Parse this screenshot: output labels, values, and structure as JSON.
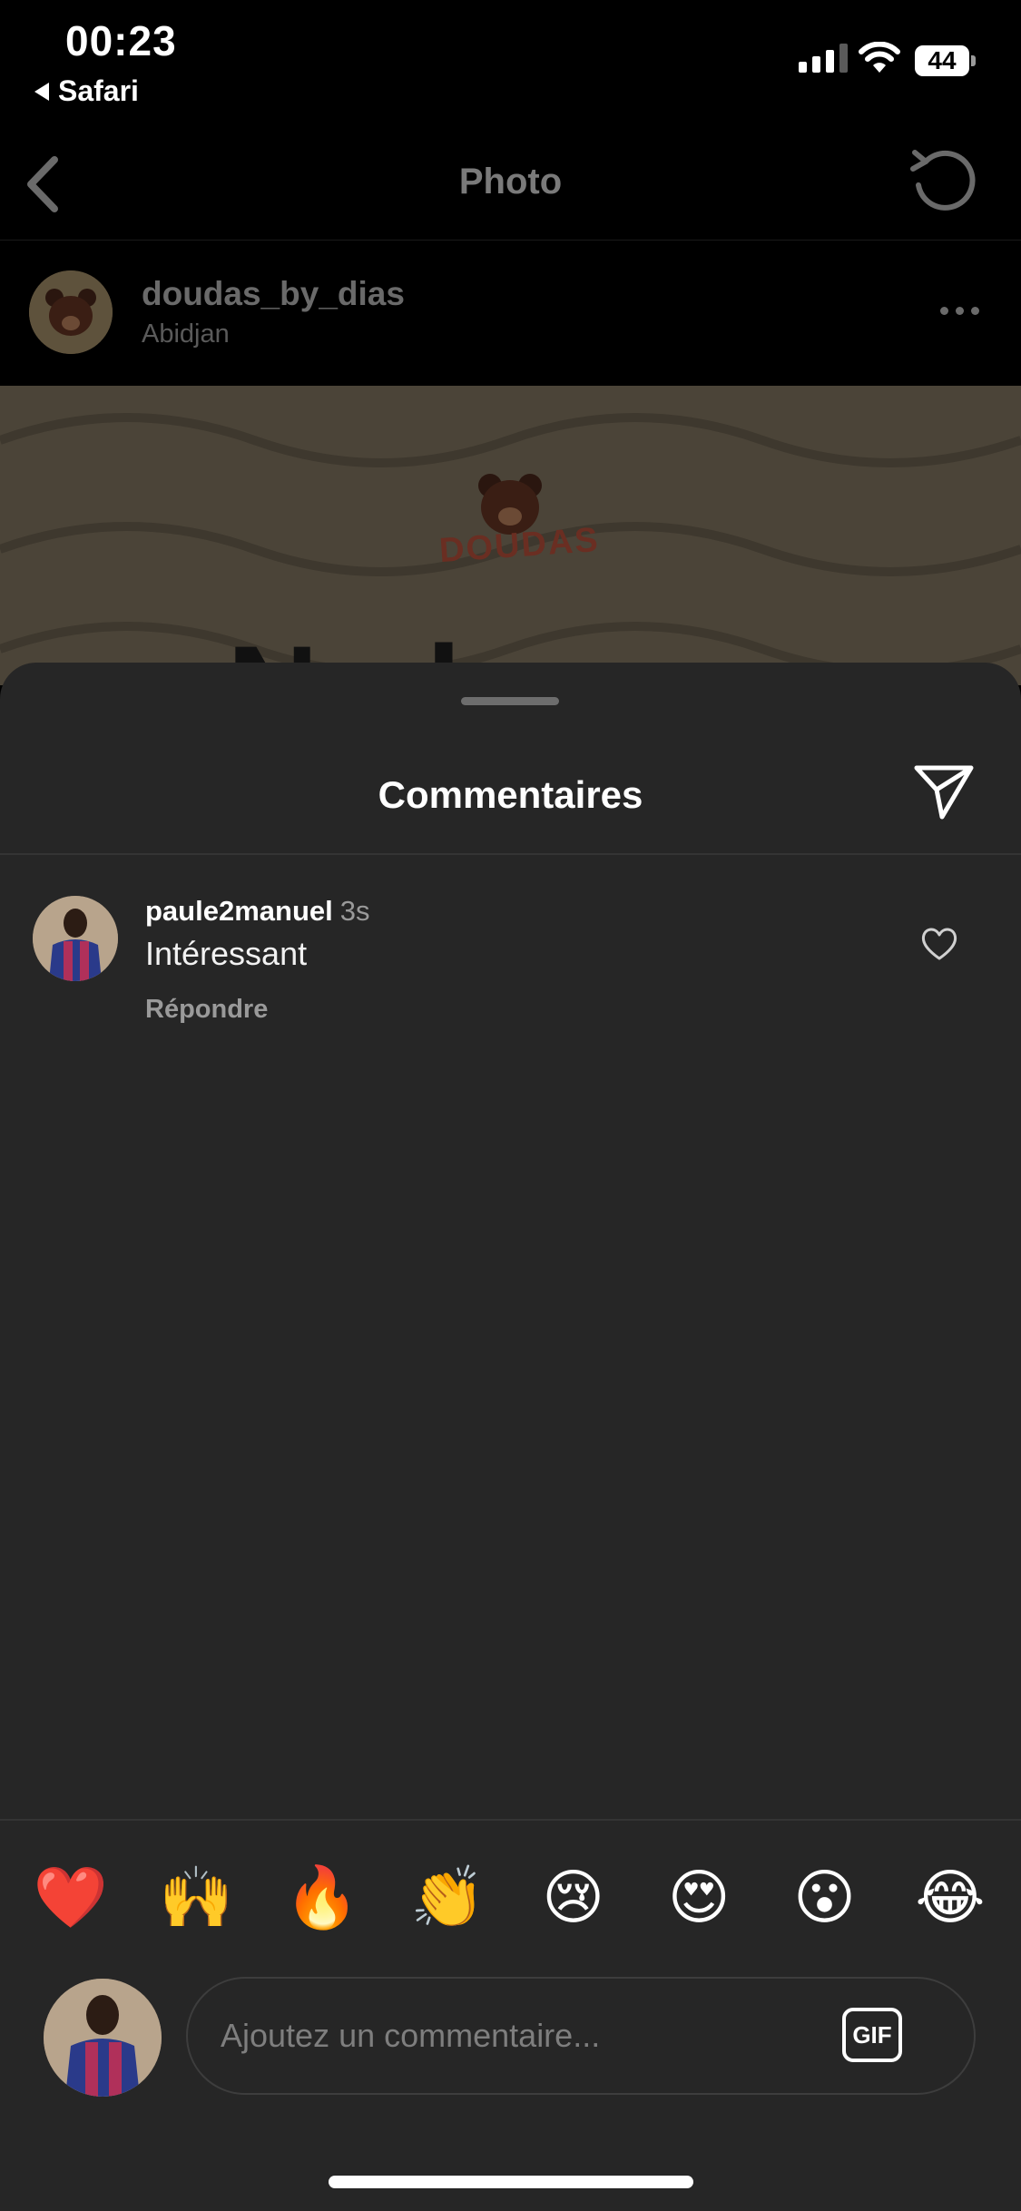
{
  "status_bar": {
    "time": "00:23",
    "back_app": "Safari",
    "battery": "44"
  },
  "background": {
    "nav_title": "Photo",
    "post_username": "doudas_by_dias",
    "post_location": "Abidjan",
    "brand_text": "DOUDAS",
    "large_word_partial": "N    ploy"
  },
  "sheet": {
    "title": "Commentaires"
  },
  "comment": {
    "username": "paule2manuel",
    "time": "3s",
    "text": "Intéressant",
    "reply_label": "Répondre"
  },
  "emojis": [
    "❤️",
    "🙌",
    "🔥",
    "👏",
    "😢",
    "😍",
    "😮",
    "😂"
  ],
  "input": {
    "placeholder": "Ajoutez un commentaire...",
    "gif_label": "GIF"
  }
}
